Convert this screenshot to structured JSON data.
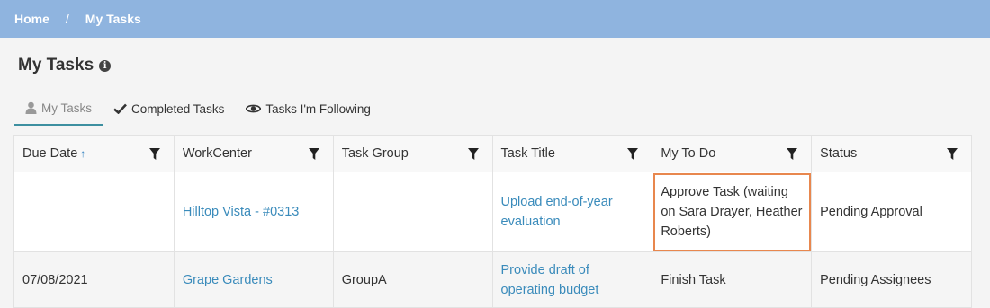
{
  "breadcrumb": {
    "home": "Home",
    "separator": "/",
    "current": "My Tasks"
  },
  "page": {
    "title": "My Tasks",
    "info_icon": "i"
  },
  "tabs": [
    {
      "label": "My Tasks",
      "icon": "user-icon",
      "active": true
    },
    {
      "label": "Completed Tasks",
      "icon": "check-icon",
      "active": false
    },
    {
      "label": "Tasks I'm Following",
      "icon": "eye-icon",
      "active": false
    }
  ],
  "table": {
    "columns": [
      {
        "label": "Due Date",
        "sort": "↑"
      },
      {
        "label": "WorkCenter"
      },
      {
        "label": "Task Group"
      },
      {
        "label": "Task Title"
      },
      {
        "label": "My To Do"
      },
      {
        "label": "Status"
      }
    ],
    "rows": [
      {
        "due_date": "",
        "workcenter": "Hilltop Vista - #0313",
        "task_group": "",
        "task_title": "Upload end-of-year evaluation",
        "my_todo": "Approve Task (waiting on Sara Drayer, Heather Roberts)",
        "status": "Pending Approval"
      },
      {
        "due_date": "07/08/2021",
        "workcenter": "Grape Gardens",
        "task_group": "GroupA",
        "task_title": "Provide draft of operating budget",
        "my_todo": "Finish Task",
        "status": "Pending Assignees"
      }
    ]
  },
  "colors": {
    "header_bar": "#8fb4df",
    "link": "#3a8bbb",
    "highlight": "#e8874e",
    "active_tab": "#3d8fa0"
  }
}
